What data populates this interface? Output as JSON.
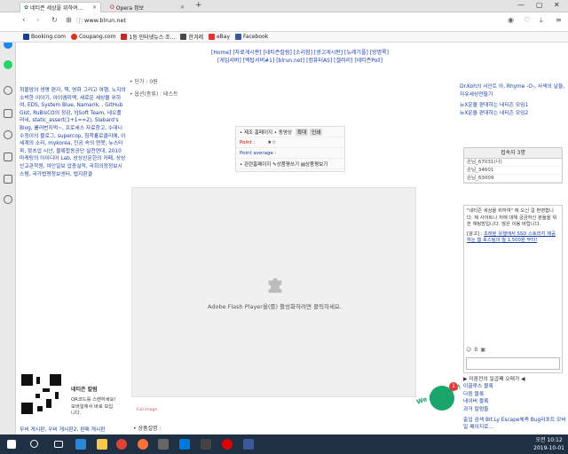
{
  "browser": {
    "tabs": [
      {
        "label": "네티즌 세상을 위하여...",
        "active": true
      },
      {
        "label": "Opera 정보",
        "active": false
      }
    ],
    "new_tab": "+",
    "address": "www.blrun.net",
    "bookmarks": [
      {
        "label": "Booking.com",
        "color": "#1a3e8c"
      },
      {
        "label": "Coupang.com",
        "color": "#e0301e"
      },
      {
        "label": "1등 인터넷뉴스 조...",
        "color": "#c62828"
      },
      {
        "label": "한겨레",
        "color": "#4a4a4a"
      },
      {
        "label": "eBay",
        "color": "#e53238"
      },
      {
        "label": "Facebook",
        "color": "#3b5998"
      }
    ]
  },
  "site": {
    "nav_line1": "[Home] [자료게시판] [네티즌칼럼] [소리함] [광고게시판] [뉴레기플] [방명록]",
    "nav_line2": "[게임서버] [엑탑서버#1] [blrun.net] [컴퓨터AS] [갤러리] [네티즌Poll]",
    "left_links": "최불암의 생명 편지, 책, 영화 그리고 여행, 노지의 소박한 이야기, 아이엠피맥, 세로운 세상을 위하여, EDS, System Blue, Namarik, , GitHub Gist, RuBisCO의 정감, YJSoft Team, 네오플러네, static_assert(1+1==2), Slabard's Blog, 롤러번지먹~, 프로세스 자료창고, 수데니 수정이의 블로그, supercop, 침착흘로클리에, 이세계의 소리, mykorea, 진공 속의 연못, 뉴스타파, 왓츠업 시넌, 블록합동공단 실천연대, 2010 마케팅의 아이디어 Lab, 상상신문한의 카페, 상상산교관학원, 여인일보 업종실적, 국회의정정보시스템, 국가법령정보센터, 법지판결",
    "mid_line1": "• 단가 : 0원",
    "mid_line2": "• 옵션(종류) : 테스트",
    "info_box": {
      "row1": "• 제조 홈페이지  • 동영상",
      "btn1": "확대",
      "btn2": "인쇄",
      "point_label": "Point :",
      "point_value": "★☆",
      "point_average": "Point average :",
      "row3": "• 관련홈페이지  ✎상품평쓰기  ▤상품평보기"
    },
    "flash_msg": "Adobe Flash Player을(를) 활성화하려면 클릭하세요.",
    "full_image": "Full image",
    "product_desc": "• 상품설명 :",
    "right_links": "Dr.Koh의 서인트 아, Rhyme -O-, 사색의 날들, 자유세상만들기",
    "right_link2": "뉴X운을 판대하는 네티즌 모임1",
    "right_link3": "뉴X운을 판대하는 네티즌 모임2",
    "visitors_title": "접속자 3명",
    "visitors": [
      "손님_67031(나)",
      "손님_34601",
      "손님_63009"
    ],
    "welcome": "\"네티즌 세상을 위하여\" 에 오신 걸 환영합니다. 제 사이트나 저에 대해 궁금하신 분들을 위한 채팅방입니다. 많은 이용 바랍니다.",
    "ad_label": "[광고] :",
    "ad_text": "초래된 유행에서 SSD 스토리지 제공하는 웹 호스팅의 월 1,500원 부터!",
    "right_bottom1": "▶ 미움전의 일곱째 오매가 ◀",
    "right_bottom2": "이끌루스 블록",
    "right_bottom3": "다음 블록",
    "right_bottom4": "네이버 블록",
    "right_bottom5": "과거 칼럼들",
    "right_bottom6": "출입 검색 Bit.Ly Escape체측 Bug리포트 모바일 페이지로...",
    "qr_title": "네티즌 칼럼",
    "qr_text": "QR코드를 스캔하세요! 모바일에서 바로 보입니다.",
    "footer_link": "무비 게시판, 우비 게시판2, 판매 게시판",
    "chat_badge_count": "1",
    "we_are_here": "We Are Here!"
  },
  "taskbar": {
    "time": "오전 10:12",
    "date": "2019-10-01"
  }
}
